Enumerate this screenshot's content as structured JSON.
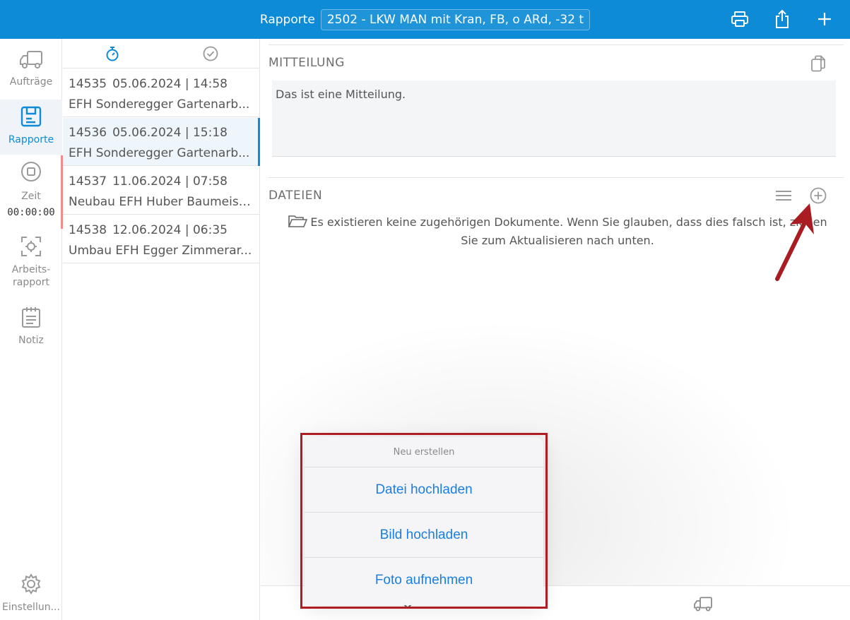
{
  "header": {
    "title": "Rapporte",
    "vehicle_selector": "2502 - LKW MAN mit Kran, FB, o ARd, -32 t",
    "icons": [
      "printer-icon",
      "share-icon",
      "plus-icon"
    ]
  },
  "nav": {
    "items": [
      {
        "label": "Aufträge",
        "icon": "truck-icon"
      },
      {
        "label": "Rapporte",
        "icon": "report-icon"
      },
      {
        "label": "Zeit",
        "icon": "stop-icon",
        "timer": "00:00:00"
      },
      {
        "label": "Arbeits-\nrapport",
        "label_line1": "Arbeits-",
        "label_line2": "rapport",
        "icon": "scan-icon"
      },
      {
        "label": "Notiz",
        "icon": "notepad-icon"
      },
      {
        "label": "Einstellun...",
        "icon": "gear-icon"
      }
    ]
  },
  "list": {
    "tabs": [
      "stopwatch-icon",
      "check-circle-icon"
    ],
    "rows": [
      {
        "number": "14535",
        "datetime": "05.06.2024 | 14:58",
        "title": "EFH Sonderegger Gartenarb..."
      },
      {
        "number": "14536",
        "datetime": "05.06.2024 | 15:18",
        "title": "EFH Sonderegger Gartenarb..."
      },
      {
        "number": "14537",
        "datetime": "11.06.2024 | 07:58",
        "title": "Neubau EFH Huber Baumeist..."
      },
      {
        "number": "14538",
        "datetime": "12.06.2024 | 06:35",
        "title": "Umbau EFH Egger Zimmerar..."
      }
    ]
  },
  "main": {
    "message_title": "MITTEILUNG",
    "message_text": "Das ist eine Mitteilung.",
    "files_title": "DATEIEN",
    "files_empty_line1": "Es existieren keine zugehörigen Dokumente. Wenn Sie glauben, dass dies falsch ist, ziehen",
    "files_empty_line2": "Sie zum Aktualisieren nach unten."
  },
  "action_sheet": {
    "title": "Neu erstellen",
    "buttons": [
      "Datei hochladen",
      "Bild hochladen",
      "Foto aufnehmen"
    ]
  },
  "colors": {
    "brand": "#0d8bd6",
    "action_text": "#1a7fe0",
    "annotation": "#b01c24"
  }
}
